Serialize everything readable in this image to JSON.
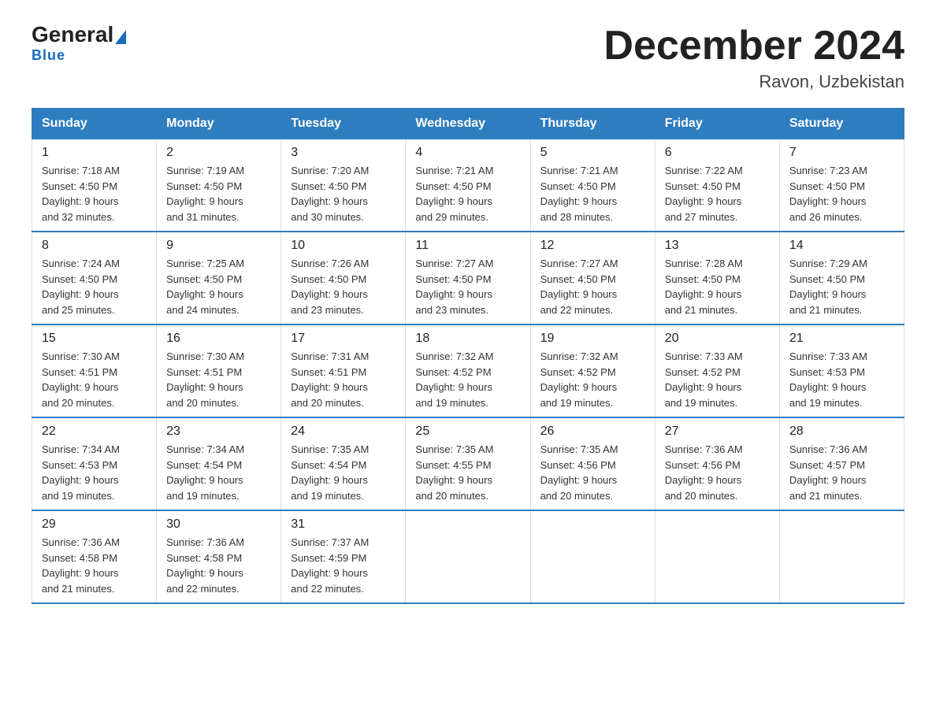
{
  "logo": {
    "general": "General",
    "blue": "Blue",
    "underline": "Blue"
  },
  "header": {
    "title": "December 2024",
    "subtitle": "Ravon, Uzbekistan"
  },
  "days_of_week": [
    "Sunday",
    "Monday",
    "Tuesday",
    "Wednesday",
    "Thursday",
    "Friday",
    "Saturday"
  ],
  "weeks": [
    [
      {
        "day": "1",
        "sunrise": "7:18 AM",
        "sunset": "4:50 PM",
        "daylight": "9 hours and 32 minutes."
      },
      {
        "day": "2",
        "sunrise": "7:19 AM",
        "sunset": "4:50 PM",
        "daylight": "9 hours and 31 minutes."
      },
      {
        "day": "3",
        "sunrise": "7:20 AM",
        "sunset": "4:50 PM",
        "daylight": "9 hours and 30 minutes."
      },
      {
        "day": "4",
        "sunrise": "7:21 AM",
        "sunset": "4:50 PM",
        "daylight": "9 hours and 29 minutes."
      },
      {
        "day": "5",
        "sunrise": "7:21 AM",
        "sunset": "4:50 PM",
        "daylight": "9 hours and 28 minutes."
      },
      {
        "day": "6",
        "sunrise": "7:22 AM",
        "sunset": "4:50 PM",
        "daylight": "9 hours and 27 minutes."
      },
      {
        "day": "7",
        "sunrise": "7:23 AM",
        "sunset": "4:50 PM",
        "daylight": "9 hours and 26 minutes."
      }
    ],
    [
      {
        "day": "8",
        "sunrise": "7:24 AM",
        "sunset": "4:50 PM",
        "daylight": "9 hours and 25 minutes."
      },
      {
        "day": "9",
        "sunrise": "7:25 AM",
        "sunset": "4:50 PM",
        "daylight": "9 hours and 24 minutes."
      },
      {
        "day": "10",
        "sunrise": "7:26 AM",
        "sunset": "4:50 PM",
        "daylight": "9 hours and 23 minutes."
      },
      {
        "day": "11",
        "sunrise": "7:27 AM",
        "sunset": "4:50 PM",
        "daylight": "9 hours and 23 minutes."
      },
      {
        "day": "12",
        "sunrise": "7:27 AM",
        "sunset": "4:50 PM",
        "daylight": "9 hours and 22 minutes."
      },
      {
        "day": "13",
        "sunrise": "7:28 AM",
        "sunset": "4:50 PM",
        "daylight": "9 hours and 21 minutes."
      },
      {
        "day": "14",
        "sunrise": "7:29 AM",
        "sunset": "4:50 PM",
        "daylight": "9 hours and 21 minutes."
      }
    ],
    [
      {
        "day": "15",
        "sunrise": "7:30 AM",
        "sunset": "4:51 PM",
        "daylight": "9 hours and 20 minutes."
      },
      {
        "day": "16",
        "sunrise": "7:30 AM",
        "sunset": "4:51 PM",
        "daylight": "9 hours and 20 minutes."
      },
      {
        "day": "17",
        "sunrise": "7:31 AM",
        "sunset": "4:51 PM",
        "daylight": "9 hours and 20 minutes."
      },
      {
        "day": "18",
        "sunrise": "7:32 AM",
        "sunset": "4:52 PM",
        "daylight": "9 hours and 19 minutes."
      },
      {
        "day": "19",
        "sunrise": "7:32 AM",
        "sunset": "4:52 PM",
        "daylight": "9 hours and 19 minutes."
      },
      {
        "day": "20",
        "sunrise": "7:33 AM",
        "sunset": "4:52 PM",
        "daylight": "9 hours and 19 minutes."
      },
      {
        "day": "21",
        "sunrise": "7:33 AM",
        "sunset": "4:53 PM",
        "daylight": "9 hours and 19 minutes."
      }
    ],
    [
      {
        "day": "22",
        "sunrise": "7:34 AM",
        "sunset": "4:53 PM",
        "daylight": "9 hours and 19 minutes."
      },
      {
        "day": "23",
        "sunrise": "7:34 AM",
        "sunset": "4:54 PM",
        "daylight": "9 hours and 19 minutes."
      },
      {
        "day": "24",
        "sunrise": "7:35 AM",
        "sunset": "4:54 PM",
        "daylight": "9 hours and 19 minutes."
      },
      {
        "day": "25",
        "sunrise": "7:35 AM",
        "sunset": "4:55 PM",
        "daylight": "9 hours and 20 minutes."
      },
      {
        "day": "26",
        "sunrise": "7:35 AM",
        "sunset": "4:56 PM",
        "daylight": "9 hours and 20 minutes."
      },
      {
        "day": "27",
        "sunrise": "7:36 AM",
        "sunset": "4:56 PM",
        "daylight": "9 hours and 20 minutes."
      },
      {
        "day": "28",
        "sunrise": "7:36 AM",
        "sunset": "4:57 PM",
        "daylight": "9 hours and 21 minutes."
      }
    ],
    [
      {
        "day": "29",
        "sunrise": "7:36 AM",
        "sunset": "4:58 PM",
        "daylight": "9 hours and 21 minutes."
      },
      {
        "day": "30",
        "sunrise": "7:36 AM",
        "sunset": "4:58 PM",
        "daylight": "9 hours and 22 minutes."
      },
      {
        "day": "31",
        "sunrise": "7:37 AM",
        "sunset": "4:59 PM",
        "daylight": "9 hours and 22 minutes."
      },
      null,
      null,
      null,
      null
    ]
  ],
  "labels": {
    "sunrise": "Sunrise:",
    "sunset": "Sunset:",
    "daylight": "Daylight:"
  }
}
